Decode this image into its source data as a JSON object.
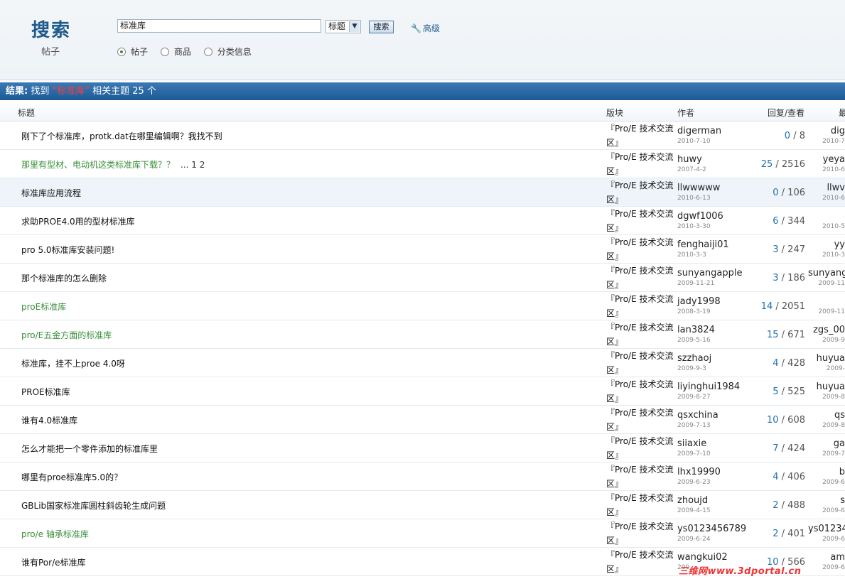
{
  "header": {
    "logo": "搜索",
    "sublabel": "帖子",
    "search_value": "标准库",
    "select_value": "标题",
    "search_button": "搜索",
    "advanced_link": "高级",
    "radios": [
      {
        "label": "帖子",
        "checked": true
      },
      {
        "label": "商品",
        "checked": false
      },
      {
        "label": "分类信息",
        "checked": false
      }
    ]
  },
  "result": {
    "prefix": "结果:",
    "found": "找到",
    "keyword": "“标准库”",
    "suffix": "相关主题",
    "count": "25 个"
  },
  "columns": {
    "title": "标题",
    "forum": "版块",
    "author": "作者",
    "replies": "回复/查看",
    "last": "最"
  },
  "rows": [
    {
      "title": "刚下了个标准库，protk.dat在哪里编辑啊？我找不到",
      "green": false,
      "pages": "",
      "forum": "『Pro/E 技术交流区』",
      "author": "digerman",
      "author_date": "2010-7-10",
      "replies": "0",
      "views": "8",
      "last": "dig",
      "last_date": "2010-7"
    },
    {
      "title": "那里有型材、电动机这类标准库下载？？",
      "green": true,
      "pages": "... 1 2",
      "forum": "『Pro/E 技术交流区』",
      "author": "huwy",
      "author_date": "2007-4-2",
      "replies": "25",
      "views": "2516",
      "last": "yeya",
      "last_date": "2010-6"
    },
    {
      "title": "标准库应用流程",
      "green": false,
      "pages": "",
      "forum": "『Pro/E 技术交流区』",
      "author": "llwwwww",
      "author_date": "2010-6-13",
      "replies": "0",
      "views": "106",
      "last": "llwv",
      "last_date": "2010-6"
    },
    {
      "title": "求助PROE4.0用的型材标准库",
      "green": false,
      "pages": "",
      "forum": "『Pro/E 技术交流区』",
      "author": "dgwf1006",
      "author_date": "2010-3-30",
      "replies": "6",
      "views": "344",
      "last": "",
      "last_date": "2010-5"
    },
    {
      "title": "pro 5.0标准库安装问题!",
      "green": false,
      "pages": "",
      "forum": "『Pro/E 技术交流区』",
      "author": "fenghaiji01",
      "author_date": "2010-3-3",
      "replies": "3",
      "views": "247",
      "last": "yy",
      "last_date": "2010-3"
    },
    {
      "title": "那个标准库的怎么删除",
      "green": false,
      "pages": "",
      "forum": "『Pro/E 技术交流区』",
      "author": "sunyangapple",
      "author_date": "2009-11-21",
      "replies": "3",
      "views": "186",
      "last": "sunyang",
      "last_date": "2009-11"
    },
    {
      "title": "proE标准库",
      "green": true,
      "pages": "",
      "forum": "『Pro/E 技术交流区』",
      "author": "jady1998",
      "author_date": "2008-3-19",
      "replies": "14",
      "views": "2051",
      "last": "",
      "last_date": "2009-11"
    },
    {
      "title": "pro/E五金方面的标准库",
      "green": true,
      "pages": "",
      "forum": "『Pro/E 技术交流区』",
      "author": "lan3824",
      "author_date": "2009-5-16",
      "replies": "15",
      "views": "671",
      "last": "zgs_00",
      "last_date": "2009-9"
    },
    {
      "title": "标准库，挂不上proe 4.0呀",
      "green": false,
      "pages": "",
      "forum": "『Pro/E 技术交流区』",
      "author": "szzhaoj",
      "author_date": "2009-9-3",
      "replies": "4",
      "views": "428",
      "last": "huyua",
      "last_date": "2009-"
    },
    {
      "title": "PROE标准库",
      "green": false,
      "pages": "",
      "forum": "『Pro/E 技术交流区』",
      "author": "liyinghui1984",
      "author_date": "2009-8-27",
      "replies": "5",
      "views": "525",
      "last": "huyua",
      "last_date": "2009-8"
    },
    {
      "title": "谁有4.0标准库",
      "green": false,
      "pages": "",
      "forum": "『Pro/E 技术交流区』",
      "author": "qsxchina",
      "author_date": "2009-7-13",
      "replies": "10",
      "views": "608",
      "last": "qs",
      "last_date": "2009-8"
    },
    {
      "title": "怎么才能把一个零件添加的标准库里",
      "green": false,
      "pages": "",
      "forum": "『Pro/E 技术交流区』",
      "author": "siiaxie",
      "author_date": "2009-7-10",
      "replies": "7",
      "views": "424",
      "last": "ga",
      "last_date": "2009-7"
    },
    {
      "title": "哪里有proe标准库5.0的？",
      "green": false,
      "pages": "",
      "forum": "『Pro/E 技术交流区』",
      "author": "lhx19990",
      "author_date": "2009-6-23",
      "replies": "4",
      "views": "406",
      "last": "b",
      "last_date": "2009-6"
    },
    {
      "title": "GBLib国家标准库圆柱斜齿轮生成问题",
      "green": false,
      "pages": "",
      "forum": "『Pro/E 技术交流区』",
      "author": "zhoujd",
      "author_date": "2009-4-15",
      "replies": "2",
      "views": "488",
      "last": "s",
      "last_date": "2009-6"
    },
    {
      "title": "pro/e 轴承标准库",
      "green": true,
      "pages": "",
      "forum": "『Pro/E 技术交流区』",
      "author": "ys0123456789",
      "author_date": "2009-6-24",
      "replies": "2",
      "views": "401",
      "last": "ys01234",
      "last_date": "2009-6"
    },
    {
      "title": "谁有Por/e标准库",
      "green": false,
      "pages": "",
      "forum": "『Pro/E 技术交流区』",
      "author": "wangkui02",
      "author_date": "200",
      "replies": "10",
      "views": "566",
      "last": "am",
      "last_date": "2009-6"
    }
  ],
  "watermark": "三维网www.3dportal.cn"
}
